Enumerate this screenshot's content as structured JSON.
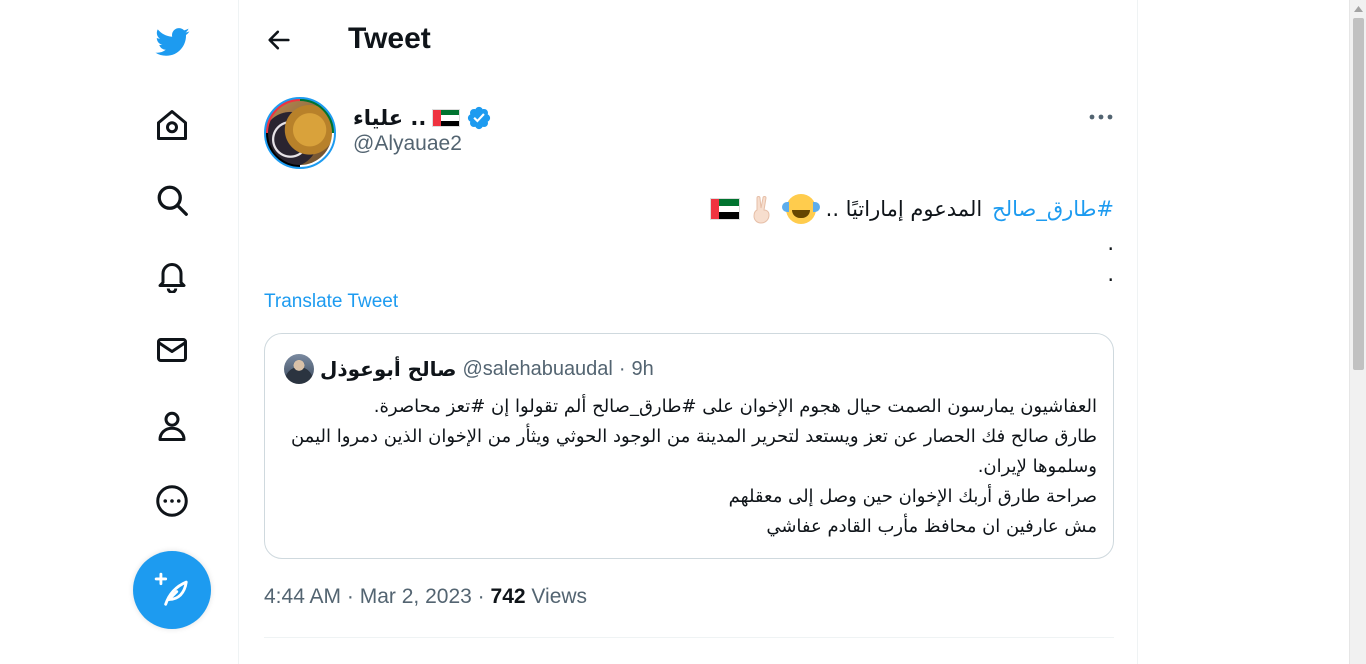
{
  "sidebar": {
    "items": [
      {
        "name": "twitter-logo",
        "icon": "twitter-bird-icon"
      },
      {
        "name": "home",
        "icon": "home-icon"
      },
      {
        "name": "explore",
        "icon": "search-icon"
      },
      {
        "name": "notifications",
        "icon": "bell-icon"
      },
      {
        "name": "messages",
        "icon": "mail-icon"
      },
      {
        "name": "profile",
        "icon": "person-icon"
      },
      {
        "name": "more",
        "icon": "more-circle-icon"
      }
    ],
    "compose_icon": "feather-plus-icon"
  },
  "header": {
    "title": "Tweet"
  },
  "tweet": {
    "author_name": ".. علياء",
    "author_handle": "@Alyauae2",
    "hashtag": "#طارق_صالح",
    "text_main": "المدعوم إماراتيًا ..",
    "dot1": ".",
    "dot2": ".",
    "translate_label": "Translate Tweet",
    "time": "4:44 AM",
    "date": "Mar 2, 2023",
    "views_count": "742",
    "views_label": "Views",
    "separator": "·"
  },
  "quote": {
    "author_name": "صالح أبوعوذل",
    "author_handle": "@salehabuaudal",
    "separator": "·",
    "time_ago": "9h",
    "lines": [
      "العفاشيون يمارسون الصمت حيال هجوم الإخوان على #طارق_صالح ألم تقولوا إن #تعز محاصرة.",
      "طارق صالح فك الحصار عن تعز  ويستعد لتحرير المدينة من الوجود الحوثي ويثأر من الإخوان الذين دمروا اليمن وسلموها لإيران.",
      "صراحة طارق أربك الإخوان حين وصل إلى معقلهم",
      "مش عارفين ان محافظ مأرب القادم عفاشي"
    ]
  },
  "colors": {
    "accent": "#1d9bf0",
    "text_primary": "#0f1419",
    "text_secondary": "#536471",
    "border": "#cfd9de"
  }
}
